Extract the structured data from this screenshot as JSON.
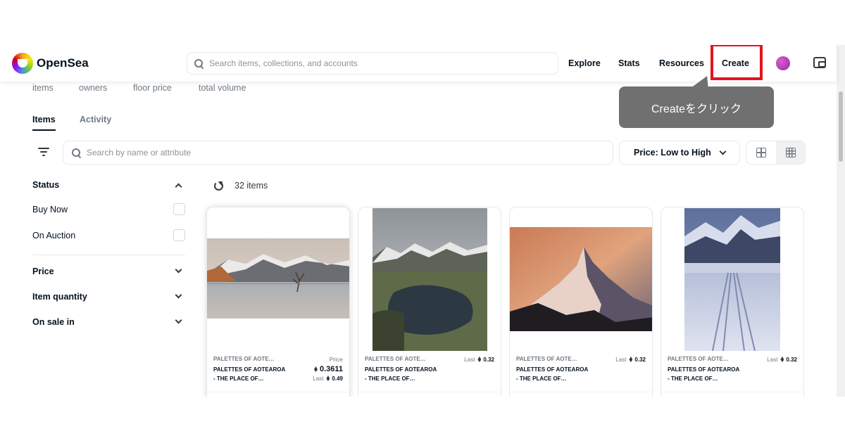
{
  "header": {
    "brand": "OpenSea",
    "search_placeholder": "Search items, collections, and accounts",
    "nav": [
      "Explore",
      "Stats",
      "Resources",
      "Create"
    ]
  },
  "stats_labels": [
    "items",
    "owners",
    "floor price",
    "total volume"
  ],
  "tooltip": {
    "text": "Createをクリック"
  },
  "tabs": [
    "Items",
    "Activity"
  ],
  "filter_bar": {
    "search_placeholder": "Search by name or attribute",
    "sort_label": "Price: Low to High"
  },
  "sidebar": {
    "status": {
      "title": "Status",
      "options": [
        "Buy Now",
        "On Auction"
      ]
    },
    "sections": [
      "Price",
      "Item quantity",
      "On sale in"
    ]
  },
  "results": {
    "count": "32 items"
  },
  "cards": [
    {
      "collection": "PALETTES OF AOTE…",
      "name_line1": "PALETTES OF AOTEAROA",
      "name_line2": "- THE PLACE OF…",
      "price_label": "Price",
      "price": "0.3611",
      "last_label": "Last",
      "last": "0.49"
    },
    {
      "collection": "PALETTES OF AOTE…",
      "name_line1": "PALETTES OF AOTEAROA",
      "name_line2": "- THE PLACE OF…",
      "last_label": "Last",
      "last": "0.32"
    },
    {
      "collection": "PALETTES OF AOTE…",
      "name_line1": "PALETTES OF AOTEAROA",
      "name_line2": "- THE PLACE OF…",
      "last_label": "Last",
      "last": "0.32"
    },
    {
      "collection": "PALETTES OF AOTE…",
      "name_line1": "PALETTES OF AOTEAROA",
      "name_line2": "- THE PLACE OF…",
      "last_label": "Last",
      "last": "0.32"
    }
  ],
  "colors": {
    "highlight": "#e3141b",
    "tooltip_bg": "#707070",
    "text": "#04111d",
    "muted": "#707a83"
  }
}
